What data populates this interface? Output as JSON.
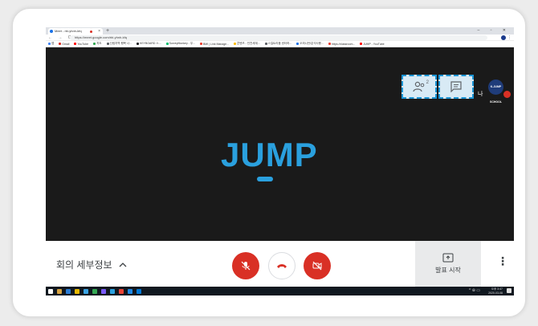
{
  "browser": {
    "tab_title": "Meet - rbi-yhnh-kfq",
    "new_tab": "+",
    "window_controls": "– ▫ ✕",
    "tab_close": "×",
    "nav_icons": "← → C",
    "url": "https://meet.google.com/rbi-yhnh-kfq",
    "bookmarks": [
      {
        "label": "앱",
        "color": "#4285f4"
      },
      {
        "label": "Gmail",
        "color": "#d93025"
      },
      {
        "label": "YouTube",
        "color": "#ff0000"
      },
      {
        "label": "지도",
        "color": "#34a853"
      },
      {
        "label": "신림지역 행복 나...",
        "color": "#5f6368"
      },
      {
        "label": "KEYBOARD 스...",
        "color": "#202124"
      },
      {
        "label": "SurveyMonkey - 무...",
        "color": "#00bf6f"
      },
      {
        "label": "BMI | Link Manage...",
        "color": "#ea4335"
      },
      {
        "label": "콘텐츠 - 인천세계...",
        "color": "#fbbc05"
      },
      {
        "label": "스킬트리움 센터하...",
        "color": "#5f6368"
      },
      {
        "label": "오피니언/분석사용...",
        "color": "#1a73e8"
      },
      {
        "label": "https://classroom...",
        "color": "#ea4335"
      },
      {
        "label": "JUMP - YouTube",
        "color": "#ff0000"
      }
    ]
  },
  "meeting": {
    "logo_text": "JUMP",
    "people_count": "2",
    "self_label": "나",
    "avatar_text": "K-JUMP SCHOOL",
    "details_label": "회의 세부정보",
    "details_chevron": "^",
    "present_label": "발표 시작",
    "more_label": "⋮"
  },
  "taskbar": {
    "time": "오후 3:47",
    "date": "2020-03-08",
    "tray": "^ ⊕ ▭"
  },
  "colors": {
    "accent": "#2aa0de",
    "danger": "#d93025",
    "video_bg": "#1a1a1a",
    "highlight": "#1b94d4"
  }
}
